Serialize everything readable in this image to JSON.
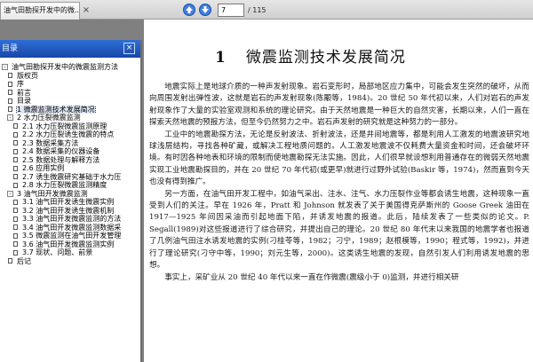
{
  "tab": {
    "title": "油气田勘探开发中的微...",
    "close": "×"
  },
  "toolbar": {
    "current_page": "7",
    "total_pages": "/ 115"
  },
  "sidebar": {
    "header": "目录",
    "close": "×",
    "items": [
      {
        "level": 0,
        "expander": "-",
        "label": "油气田勘探开发中的微震监测方法"
      },
      {
        "level": 1,
        "expander": "",
        "label": "版权页"
      },
      {
        "level": 1,
        "expander": "",
        "label": "序"
      },
      {
        "level": 1,
        "expander": "",
        "label": "前言"
      },
      {
        "level": 1,
        "expander": "",
        "label": "目录"
      },
      {
        "level": 1,
        "expander": "",
        "label": "1  微震监测技术发展简况",
        "selected": true
      },
      {
        "level": 1,
        "expander": "-",
        "label": "2  水力压裂微震监测"
      },
      {
        "level": 2,
        "expander": "",
        "label": "2.1  水力压裂微震监测原理"
      },
      {
        "level": 2,
        "expander": "",
        "label": "2.2  水力压裂诱生微震的特点"
      },
      {
        "level": 2,
        "expander": "",
        "label": "2.3  数据采集方法"
      },
      {
        "level": 2,
        "expander": "",
        "label": "2.4  数据采集的仪器设备"
      },
      {
        "level": 2,
        "expander": "",
        "label": "2.5  数据处理与解释方法"
      },
      {
        "level": 2,
        "expander": "",
        "label": "2.6  应用实例"
      },
      {
        "level": 2,
        "expander": "",
        "label": "2.7  诱生微震研究基础于水力压"
      },
      {
        "level": 2,
        "expander": "",
        "label": "2.8  水力压裂微震监测精度"
      },
      {
        "level": 1,
        "expander": "-",
        "label": "3  油气田开发微震监测"
      },
      {
        "level": 2,
        "expander": "",
        "label": "3.1  油气田开发诱生微震实例"
      },
      {
        "level": 2,
        "expander": "",
        "label": "3.2  油气田开发诱生微震机制"
      },
      {
        "level": 2,
        "expander": "",
        "label": "3.3  油气田开发微震监测的方法"
      },
      {
        "level": 2,
        "expander": "",
        "label": "3.4  油气田开发微震监测数据采"
      },
      {
        "level": 2,
        "expander": "",
        "label": "3.5  微震监测在油气田开发管理"
      },
      {
        "level": 2,
        "expander": "",
        "label": "3.6  油气田开发微震监测实例"
      },
      {
        "level": 2,
        "expander": "",
        "label": "3.7  现状、问题、前景"
      },
      {
        "level": 1,
        "expander": "",
        "label": "后记"
      }
    ]
  },
  "page": {
    "chapter_number": "1",
    "chapter_title": "微震监测技术发展简况",
    "paragraphs": [
      "地震实际上是地球介质的一种声发射现象。岩石变形时，局部地区应力集中，可能会发生突然的破坏，从而向周围发射出弹性波，这就是岩石的声发射现象(陈颙等，1984)。20 世纪 50 年代初以来，人们对岩石的声发射现象作了大量的实验室观测和系统的理论研究。由于天然地震是一种巨大的自然灾害，长期以来，人们一直在探索天然地震的预报方法，但至今仍然努力之中。岩石声发射的研究就是这种努力的一部分。",
      "工业中的地震勘探方法，无论是反射波法、折射波法，还是井间地震等，都是利用人工激发的地震波研究地球浅层结构，寻找各种矿藏，或解决工程地质问题的。人工激发地震波不仅耗费大量资金和时间，还会破坏环境。有时因各种地表和环境的限制而使地震勘探无法实施。因此，人们很早就设想利用普通存在的微弱天然地震实现工业地震勘探目的，并在 20 世纪 70 年代初(或更早)就进行过野外试验(Baskir 等，1974)，然而直到今天也没有得到推广。",
      "另一方面，在油气田开发工程中，如油气采出、注水、注气、水力压裂作业等都会诱生地震，这种现象一直受到人们的关注。早在 1926 年，Pratt 和 Johnson 就发表了关于美国得克萨斯州的 Goose Greek 油田在 1917—1925 年间因采油而引起地面下陷，并诱发地震的报道。此后，陆续发表了一些类似的论文。P. Segall(1989)对这些报道进行了综合研究，并提出自己的理论。20 世纪 80 年代末以来我国的地震学者也报道了几例油气田注水诱发地震的实例(刁桂苓等，1982；刁宁，1989；赵根模等，1990；程式等，1992)，并进行了理论研究(刁守中等，1990；刘元生等，2000)。这类诱生地震的发现，自然引发人们利用诱发地震的思想。",
      "事实上，采矿业从 20 世纪 40 年代以来一直在作微震(震级小于 0)监测，并进行相关研"
    ]
  }
}
